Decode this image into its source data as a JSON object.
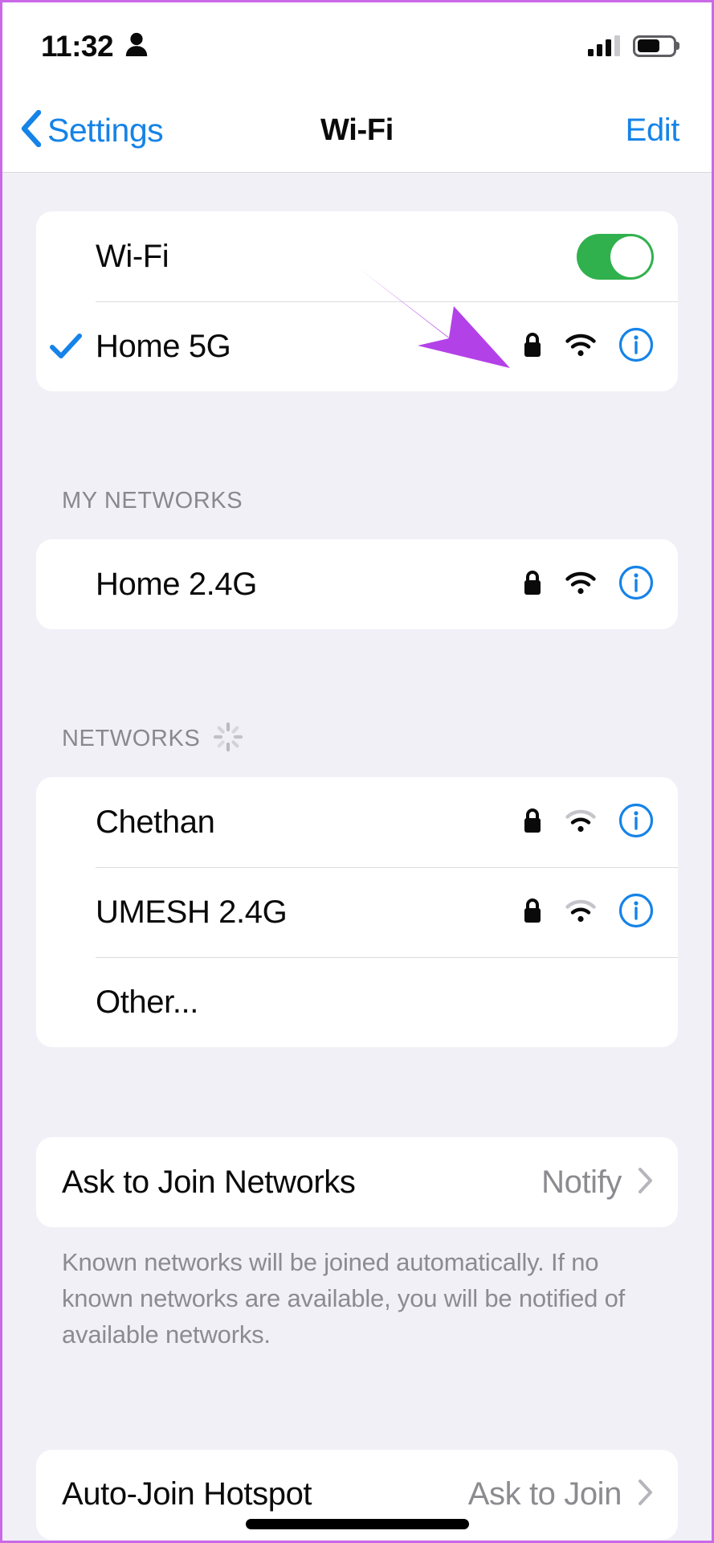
{
  "status_bar": {
    "time": "11:32",
    "person_icon": "person-icon",
    "cellular_icon": "cellular-signal-icon",
    "cellular_bars_filled": 3,
    "cellular_bars_total": 4,
    "battery_icon": "battery-icon",
    "battery_level_percent": 65
  },
  "nav_bar": {
    "back_label": "Settings",
    "back_icon": "chevron-left-icon",
    "title": "Wi-Fi",
    "edit_label": "Edit"
  },
  "wifi_section": {
    "toggle_label": "Wi-Fi",
    "toggle_on": true,
    "connected_network": {
      "name": "Home 5G",
      "checkmark_icon": "checkmark-icon",
      "secured": true,
      "signal_strength": 3,
      "info_icon": "info-circle-icon"
    }
  },
  "my_networks": {
    "header": "MY NETWORKS",
    "items": [
      {
        "name": "Home 2.4G",
        "secured": true,
        "signal_strength": 3,
        "info_icon": "info-circle-icon"
      }
    ]
  },
  "networks": {
    "header": "NETWORKS",
    "scanning": true,
    "spinner_icon": "activity-spinner-icon",
    "items": [
      {
        "name": "Chethan",
        "secured": true,
        "signal_strength": 2,
        "info_icon": "info-circle-icon"
      },
      {
        "name": "UMESH 2.4G",
        "secured": true,
        "signal_strength": 2,
        "info_icon": "info-circle-icon"
      }
    ],
    "other_label": "Other..."
  },
  "ask_to_join": {
    "label": "Ask to Join Networks",
    "value": "Notify",
    "chevron_icon": "chevron-right-icon",
    "footer": "Known networks will be joined automatically. If no known networks are available, you will be notified of available networks."
  },
  "auto_join_hotspot": {
    "label": "Auto-Join Hotspot",
    "value": "Ask to Join",
    "chevron_icon": "chevron-right-icon"
  },
  "annotation": {
    "arrow_icon": "annotation-arrow-icon",
    "arrow_color": "#B341E8",
    "points_at": "lock-icon"
  },
  "colors": {
    "accent_blue": "#1583E8",
    "toggle_green": "#30B14D",
    "background": "#F1F0F6",
    "card": "#FFFFFF",
    "secondary_text": "#8B8B90",
    "frame_border": "#C969E8"
  }
}
